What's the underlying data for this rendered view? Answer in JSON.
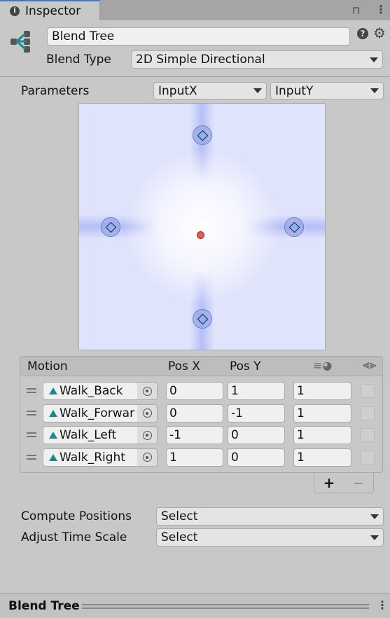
{
  "tab": {
    "title": "Inspector",
    "icon": "info-icon"
  },
  "header": {
    "name": "Blend Tree",
    "blend_type_label": "Blend Type",
    "blend_type": "2D Simple Directional"
  },
  "parameters": {
    "label": "Parameters",
    "x": "InputX",
    "y": "InputY"
  },
  "table": {
    "headers": {
      "motion": "Motion",
      "pos_x": "Pos X",
      "pos_y": "Pos Y"
    },
    "rows": [
      {
        "motion": "Walk_Back",
        "pos_x": "0",
        "pos_y": "1",
        "speed": "1",
        "mirror": false
      },
      {
        "motion": "Walk_Forwar",
        "pos_x": "0",
        "pos_y": "-1",
        "speed": "1",
        "mirror": false
      },
      {
        "motion": "Walk_Left",
        "pos_x": "-1",
        "pos_y": "0",
        "speed": "1",
        "mirror": false
      },
      {
        "motion": "Walk_Right",
        "pos_x": "1",
        "pos_y": "0",
        "speed": "1",
        "mirror": false
      }
    ],
    "add": "+",
    "remove": "−"
  },
  "compute": {
    "label": "Compute Positions",
    "value": "Select"
  },
  "adjust": {
    "label": "Adjust Time Scale",
    "value": "Select"
  },
  "footer": {
    "title": "Blend Tree"
  },
  "colors": {
    "accent": "#3a79d5",
    "clip": "#1a8a8f",
    "parameter_point": "#e35a4f"
  }
}
